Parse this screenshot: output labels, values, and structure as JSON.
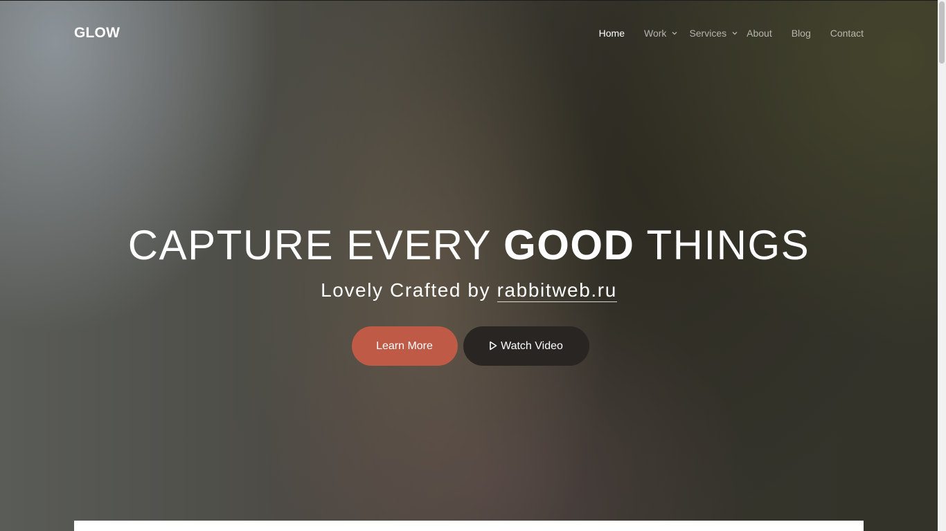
{
  "brand": {
    "logo": "GLOW"
  },
  "nav": {
    "items": [
      {
        "label": "Home",
        "active": true,
        "has_dropdown": false
      },
      {
        "label": "Work",
        "active": false,
        "has_dropdown": true
      },
      {
        "label": "Services",
        "active": false,
        "has_dropdown": true
      },
      {
        "label": "About",
        "active": false,
        "has_dropdown": false
      },
      {
        "label": "Blog",
        "active": false,
        "has_dropdown": false
      },
      {
        "label": "Contact",
        "active": false,
        "has_dropdown": false
      }
    ]
  },
  "hero": {
    "headline_part1": "CAPTURE EVERY ",
    "headline_bold": "GOOD",
    "headline_part2": " THINGS",
    "subline_prefix": "Lovely Crafted by ",
    "subline_link": "rabbitweb.ru",
    "primary_button": "Learn More",
    "secondary_button": "Watch Video"
  },
  "icons": {
    "dropdown": "chevron-down-icon",
    "video": "play-icon"
  },
  "colors": {
    "accent": "#bf5a46",
    "dark_button": "#282522",
    "text": "#ffffff"
  }
}
